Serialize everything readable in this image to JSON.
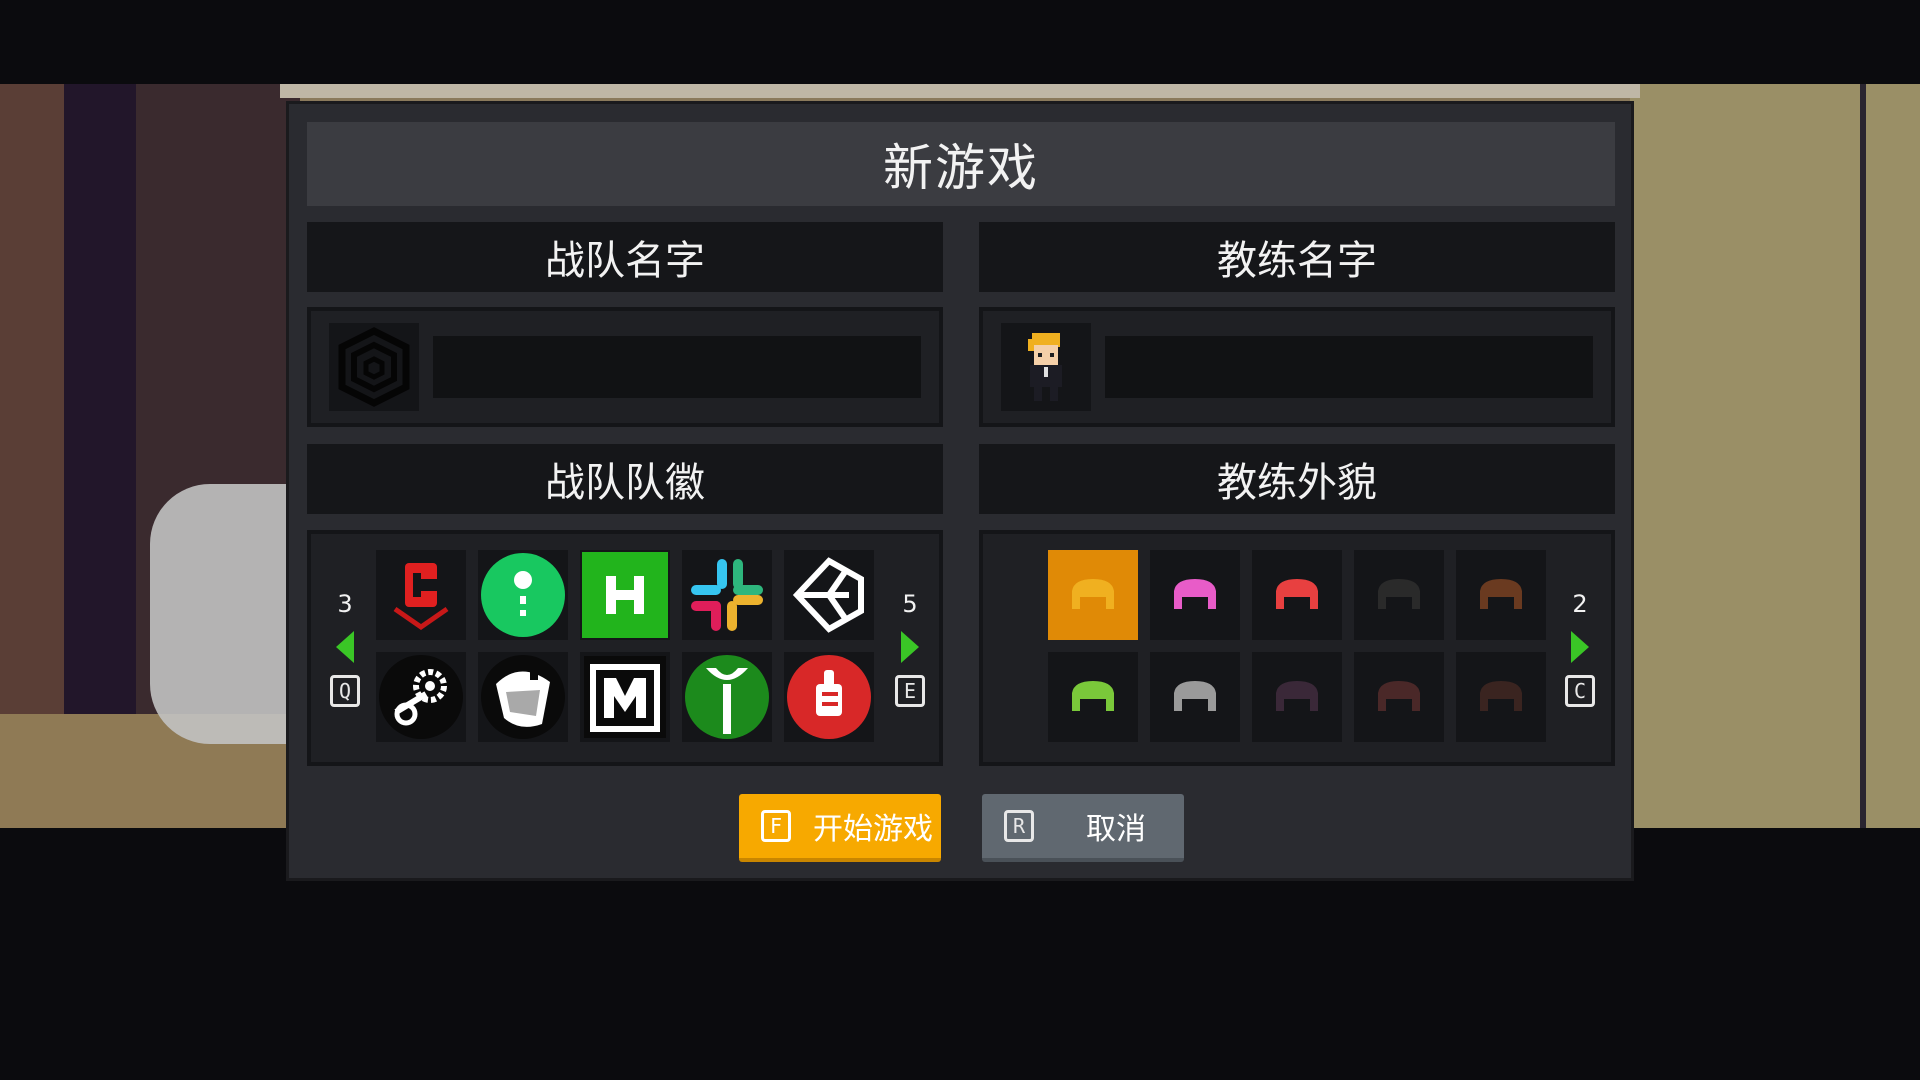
{
  "dialog": {
    "title": "新游戏",
    "team_name": {
      "heading": "战队名字",
      "value": "",
      "placeholder": ""
    },
    "coach_name": {
      "heading": "教练名字",
      "value": "",
      "placeholder": ""
    },
    "team_logo": {
      "heading": "战队队徽",
      "prev_page": "3",
      "next_page": "5",
      "prev_key": "Q",
      "next_key": "E",
      "logos": [
        "red-c-logo",
        "green-exclamation-logo",
        "green-h-logo",
        "slack-logo",
        "unity-logo",
        "gear-logo",
        "shark-logo",
        "m-logo",
        "green-y-logo",
        "red-fist-logo"
      ]
    },
    "coach_look": {
      "heading": "教练外貌",
      "next_page": "2",
      "next_key": "C",
      "hair_colors": [
        "#f0b020",
        "#e85cc8",
        "#e84040",
        "#2a2a2a",
        "#6a3a20",
        "#7ac83a",
        "#9a9a9a",
        "#3a2838",
        "#4a2828",
        "#3a2420"
      ],
      "selected_index": 0
    },
    "buttons": {
      "start_key": "F",
      "start_label": "开始游戏",
      "cancel_key": "R",
      "cancel_label": "取消"
    }
  },
  "colors": {
    "accent": "#f7a900",
    "selected": "#e08a06",
    "arrow": "#3ac626",
    "panel": "#2a2b30"
  }
}
